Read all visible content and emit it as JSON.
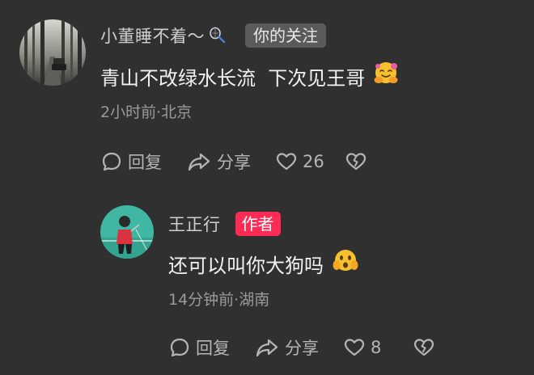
{
  "comments": [
    {
      "username": "小董睡不着～",
      "username_badge_icon": "badminton-racket-icon",
      "relation_badge": "你的关注",
      "text": "青山不改绿水长流  下次见王哥",
      "emoji_icon": "hugging-face-emoji",
      "time": "2小时前",
      "location": "北京",
      "meta": "2小时前·北京",
      "actions": {
        "reply_label": "回复",
        "share_label": "分享",
        "like_count": "26"
      }
    },
    {
      "username": "王正行",
      "author_badge": "作者",
      "text": "还可以叫你大狗吗",
      "emoji_icon": "shocked-face-emoji",
      "meta": "14分钟前·湖南",
      "actions": {
        "reply_label": "回复",
        "share_label": "分享",
        "like_count": "8"
      }
    }
  ],
  "colors": {
    "background": "#303030",
    "author_badge": "#fe2c55",
    "follow_badge": "#5a5a5a",
    "secondary_text": "#9a9a9a"
  }
}
